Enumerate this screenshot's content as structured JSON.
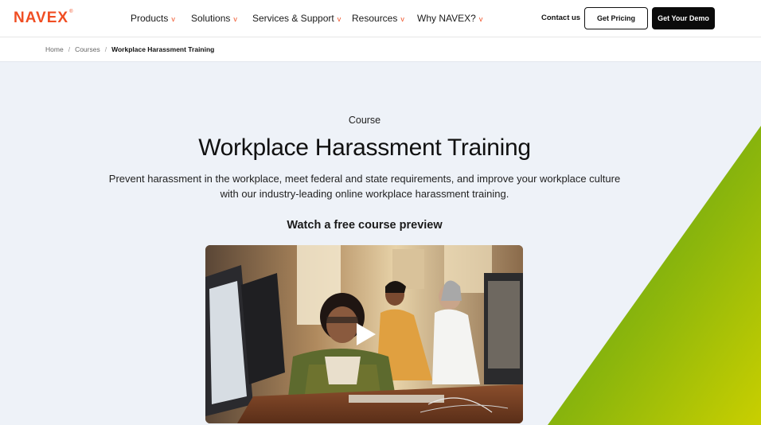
{
  "header": {
    "logo": "NAVEX",
    "logo_mark": "®",
    "nav": [
      {
        "label": "Products",
        "chevron": "v"
      },
      {
        "label": "Solutions",
        "chevron": "v"
      },
      {
        "label": "Services & Support",
        "chevron": "v"
      },
      {
        "label": "Resources",
        "chevron": "v"
      },
      {
        "label": "Why NAVEX?",
        "chevron": "v"
      }
    ],
    "contact": "Contact us",
    "pricing_button": "Get Pricing",
    "demo_button": "Get Your Demo"
  },
  "breadcrumb": {
    "items": [
      "Home",
      "Courses"
    ],
    "separator": "/",
    "current": "Workplace Harassment Training"
  },
  "hero": {
    "eyebrow": "Course",
    "title": "Workplace Harassment Training",
    "description": "Prevent harassment in the workplace, meet federal and state requirements, and improve your workplace culture with our industry-leading online workplace harassment training.",
    "preview_label": "Watch a free course preview"
  },
  "video": {
    "play_icon": "play-icon"
  },
  "colors": {
    "brand": "#f04e23",
    "hero_bg": "#eef2f8",
    "green_dark": "#5c9a1a",
    "green_light": "#c7cf00"
  }
}
